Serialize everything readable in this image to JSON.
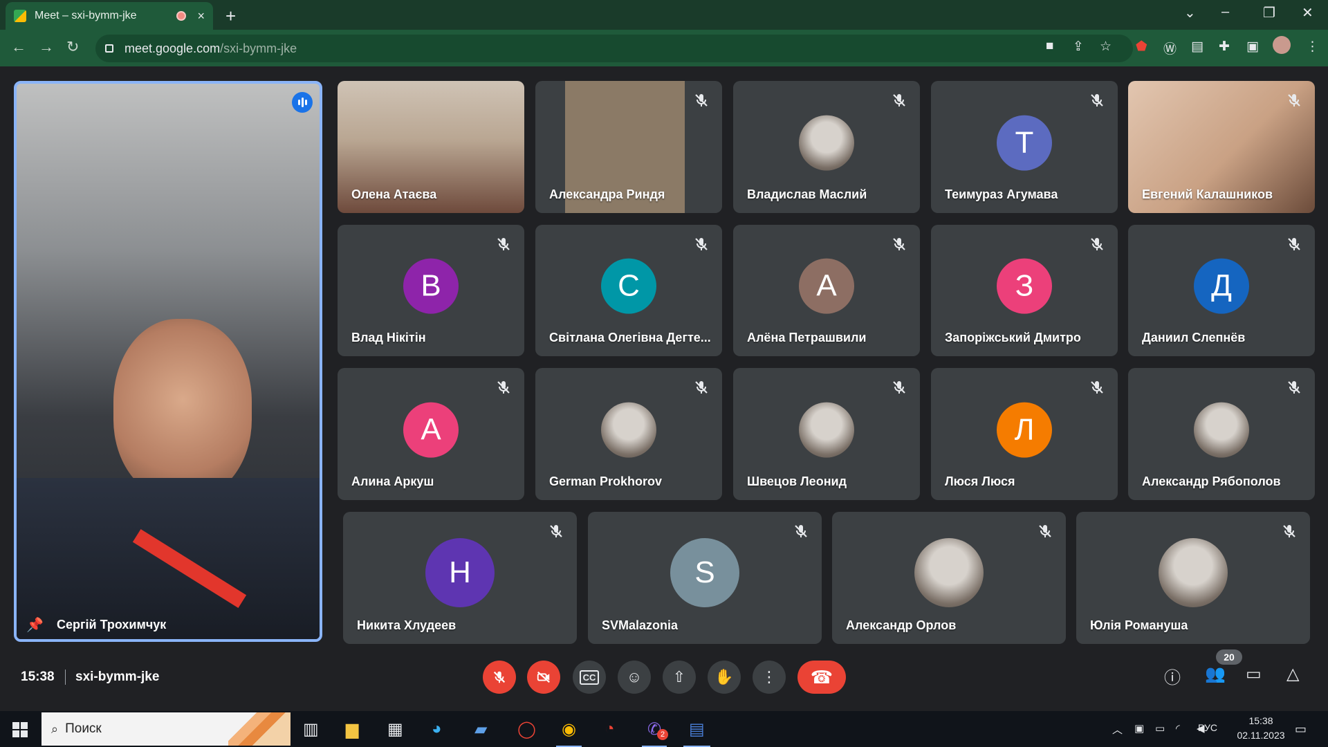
{
  "browser": {
    "tab_title": "Meet – sxi-bymm-jke",
    "url_host": "meet.google.com",
    "url_path": "/sxi-bymm-jke",
    "new_tab_label": "+",
    "tab_close_label": "×"
  },
  "presenter": {
    "name": "Сергій Трохимчук"
  },
  "participants": [
    {
      "name": "Олена Атаєва",
      "kind": "video",
      "muted": false
    },
    {
      "name": "Александра Риндя",
      "kind": "video",
      "muted": true
    },
    {
      "name": "Владислав Маслий",
      "kind": "photo",
      "muted": true
    },
    {
      "name": "Теимураз Агумава",
      "kind": "letter",
      "letter": "T",
      "color": "#5c6bc0",
      "muted": true
    },
    {
      "name": "Евгений Калашников",
      "kind": "video",
      "muted": true
    },
    {
      "name": "Влад Нікітін",
      "kind": "letter",
      "letter": "В",
      "color": "#8e24aa",
      "muted": true
    },
    {
      "name": "Світлана Олегівна Дегте...",
      "kind": "letter",
      "letter": "С",
      "color": "#0097a7",
      "muted": true
    },
    {
      "name": "Алёна Петрашвили",
      "kind": "letter",
      "letter": "А",
      "color": "#8d6e63",
      "muted": true
    },
    {
      "name": "Запоріжський Дмитро",
      "kind": "letter",
      "letter": "З",
      "color": "#ec407a",
      "muted": true
    },
    {
      "name": "Даниил Слепнёв",
      "kind": "letter",
      "letter": "Д",
      "color": "#1565c0",
      "muted": true
    },
    {
      "name": "Алина Аркуш",
      "kind": "letter",
      "letter": "А",
      "color": "#ec407a",
      "muted": true
    },
    {
      "name": "German Prokhorov",
      "kind": "photo",
      "muted": true
    },
    {
      "name": "Швецов Леонид",
      "kind": "photo",
      "muted": true
    },
    {
      "name": "Люся Люся",
      "kind": "letter",
      "letter": "Л",
      "color": "#f57c00",
      "muted": true
    },
    {
      "name": "Александр Рябополов",
      "kind": "photo",
      "muted": true
    },
    {
      "name": "Никита Хлудеев",
      "kind": "letter",
      "letter": "Н",
      "color": "#5e35b1",
      "muted": true
    },
    {
      "name": "SVMalazonia",
      "kind": "letter",
      "letter": "S",
      "color": "#78909c",
      "muted": true
    },
    {
      "name": "Александр Орлов",
      "kind": "photo",
      "muted": true
    },
    {
      "name": "Юлія Романуша",
      "kind": "photo",
      "muted": true
    }
  ],
  "meeting": {
    "time": "15:38",
    "code": "sxi-bymm-jke",
    "participant_count": "20"
  },
  "taskbar": {
    "search_placeholder": "Поиск",
    "language": "РУС",
    "clock_time": "15:38",
    "clock_date": "02.11.2023",
    "viber_badge": "2"
  }
}
